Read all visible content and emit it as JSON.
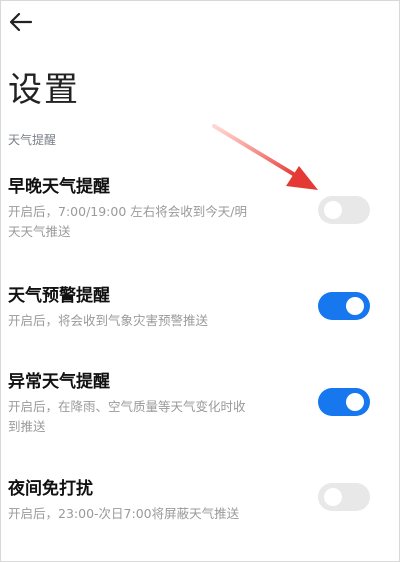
{
  "header": {
    "back_icon": "back-arrow-icon",
    "title": "设置"
  },
  "section": {
    "label": "天气提醒"
  },
  "items": [
    {
      "title": "早晚天气提醒",
      "desc_line1": "开启后，7:00/19:00 左右将会收到今天/明",
      "desc_line2": "天天气推送",
      "enabled": false
    },
    {
      "title": "天气预警提醒",
      "desc_line1": "开启后，将会收到气象灾害预警推送",
      "desc_line2": "",
      "enabled": true
    },
    {
      "title": "异常天气提醒",
      "desc_line1": "开启后，在降雨、空气质量等天气变化时收",
      "desc_line2": "到推送",
      "enabled": true
    },
    {
      "title": "夜间免打扰",
      "desc_line1": "开启后，23:00-次日7:00将屏蔽天气推送",
      "desc_line2": "",
      "enabled": false
    }
  ],
  "colors": {
    "toggle_on": "#1677ef",
    "toggle_off": "#e8e8e8",
    "annotation_arrow": "#e53935"
  }
}
